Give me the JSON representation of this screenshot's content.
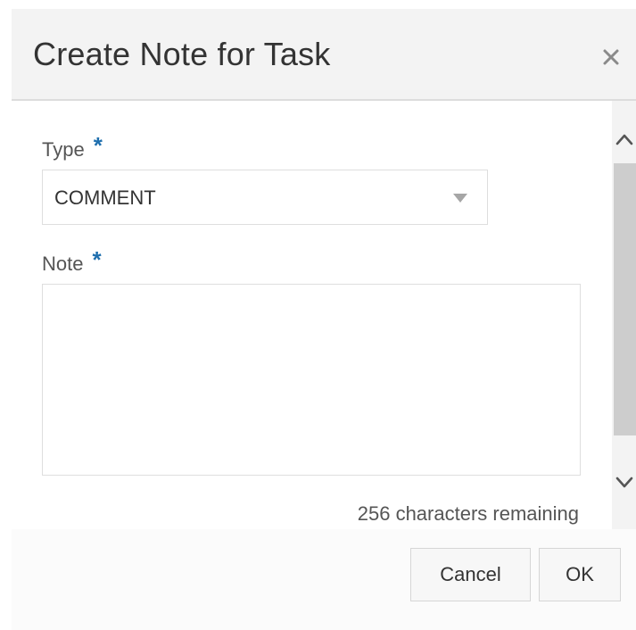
{
  "dialog": {
    "title": "Create Note for Task",
    "close_icon": "close-icon"
  },
  "form": {
    "type": {
      "label": "Type",
      "required_mark": "*",
      "selected_value": "COMMENT",
      "caret_icon": "caret-down-icon"
    },
    "note": {
      "label": "Note",
      "required_mark": "*",
      "value": "",
      "placeholder": ""
    },
    "characters_remaining": "256 characters remaining"
  },
  "scrollbar": {
    "up_icon": "chevron-up-icon",
    "down_icon": "chevron-down-icon"
  },
  "footer": {
    "cancel_label": "Cancel",
    "ok_label": "OK"
  },
  "colors": {
    "required_accent": "#1f6fae",
    "header_bg": "#f3f3f3",
    "text": "#333333"
  }
}
